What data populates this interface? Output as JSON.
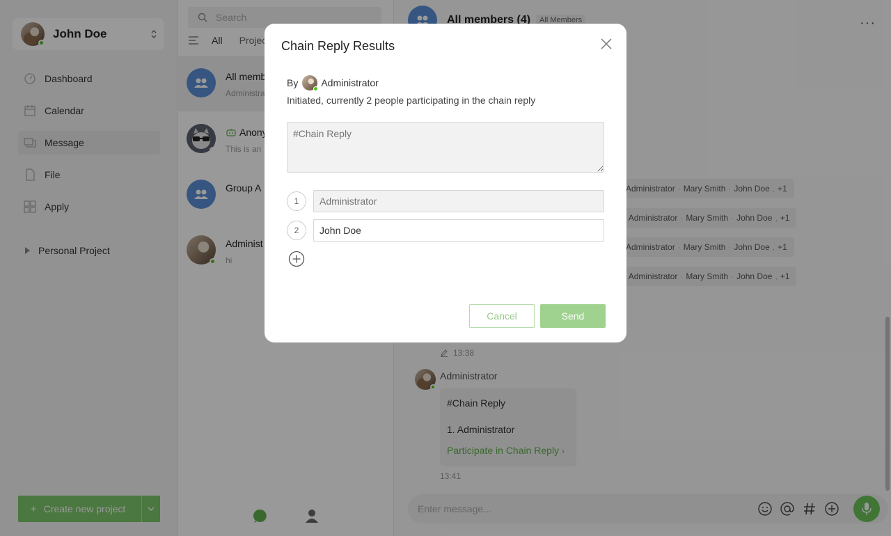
{
  "user": {
    "name": "John Doe"
  },
  "nav": [
    {
      "label": "Dashboard",
      "icon": "dashboard-icon"
    },
    {
      "label": "Calendar",
      "icon": "calendar-icon"
    },
    {
      "label": "Message",
      "icon": "message-icon",
      "active": true
    },
    {
      "label": "File",
      "icon": "file-icon"
    },
    {
      "label": "Apply",
      "icon": "apply-icon"
    }
  ],
  "project_section": {
    "label": "Personal Project"
  },
  "create_button": {
    "label": "Create new project"
  },
  "convlist": {
    "search_placeholder": "Search",
    "tabs": [
      "All",
      "Projec"
    ],
    "items": [
      {
        "title": "All memb",
        "preview": "Administra"
      },
      {
        "title": "Anony",
        "preview": "This is an"
      },
      {
        "title": "Group A",
        "preview": ""
      },
      {
        "title": "Administ",
        "preview": "hi"
      }
    ]
  },
  "chat": {
    "title": "All members (4)",
    "tag": "All Members",
    "read_rows": [
      {
        "prefix": "",
        "names": [
          "Administrator",
          "Mary Smith",
          "John Doe"
        ],
        "extra": "+1"
      },
      {
        "prefix": "e",
        "names": [
          "Administrator",
          "Mary Smith",
          "John Doe"
        ],
        "extra": "+1"
      },
      {
        "prefix": "",
        "names": [
          "Administrator",
          "Mary Smith",
          "John Doe"
        ],
        "extra": "+1"
      },
      {
        "prefix": "e",
        "names": [
          "Administrator",
          "Mary Smith",
          "John Doe"
        ],
        "extra": "+1"
      }
    ],
    "edited_time": "13:38",
    "message": {
      "sender": "Administrator",
      "line1": "#Chain Reply",
      "line2": "1. Administrator",
      "link": "Participate in Chain Reply",
      "time": "13:41"
    },
    "composer_placeholder": "Enter message..."
  },
  "modal": {
    "title": "Chain Reply Results",
    "by_label": "By",
    "initiator": "Administrator",
    "summary": "Initiated, currently 2 people participating in the chain reply",
    "topic_placeholder": "#Chain Reply",
    "entries": [
      {
        "number": "1",
        "value": "",
        "placeholder": "Administrator",
        "disabled": true
      },
      {
        "number": "2",
        "value": "John Doe",
        "placeholder": "",
        "disabled": false
      }
    ],
    "cancel_label": "Cancel",
    "send_label": "Send"
  },
  "colors": {
    "accent": "#6cc45b",
    "link": "#5fb04a",
    "group_avatar": "#5b8fd8",
    "online": "#52c41a"
  }
}
